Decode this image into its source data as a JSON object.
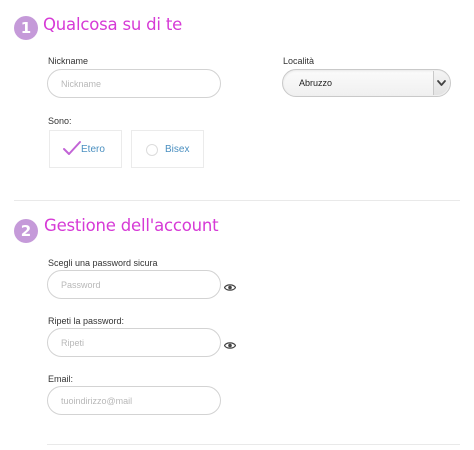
{
  "theme": {
    "accent": "#d63ad6",
    "badge": "#c59ad9",
    "link": "#4a8fc0"
  },
  "section1": {
    "number": "1",
    "title": "Qualcosa su di te",
    "nickname": {
      "label": "Nickname",
      "placeholder": "Nickname",
      "value": ""
    },
    "location": {
      "label": "Località",
      "selected": "Abruzzo"
    },
    "orientation": {
      "label": "Sono:",
      "options": [
        {
          "label": "Etero",
          "selected": true
        },
        {
          "label": "Bisex",
          "selected": false
        }
      ]
    }
  },
  "section2": {
    "number": "2",
    "title": "Gestione dell'account",
    "password": {
      "label": "Scegli una password sicura",
      "placeholder": "Password",
      "icon": "eye-icon"
    },
    "password_repeat": {
      "label": "Ripeti la password:",
      "placeholder": "Ripeti",
      "icon": "eye-icon"
    },
    "email": {
      "label": "Email:",
      "placeholder": "tuoindirizzo@mail"
    }
  }
}
